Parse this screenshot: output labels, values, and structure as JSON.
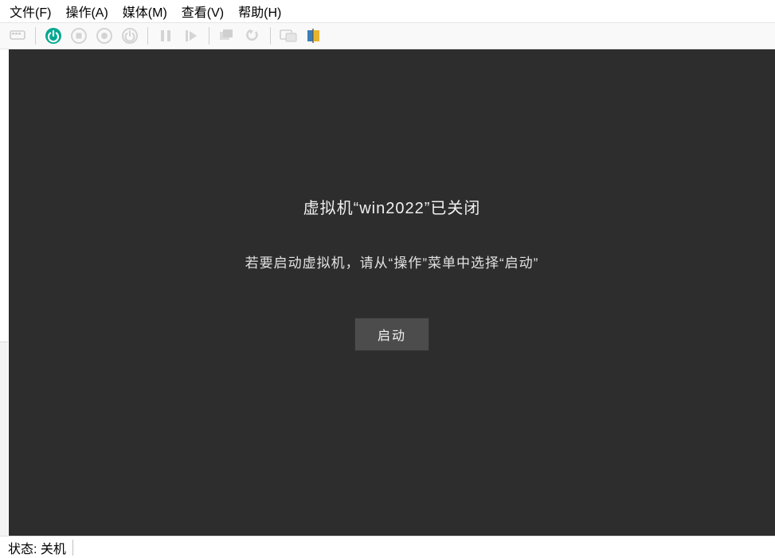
{
  "menu": {
    "file": "文件(F)",
    "action": "操作(A)",
    "media": "媒体(M)",
    "view": "查看(V)",
    "help": "帮助(H)"
  },
  "toolbar": {
    "ctrl_alt_del_icon": "ctrl-alt-del-icon",
    "start_icon": "power-on-icon",
    "turnoff_icon": "stop-icon",
    "shutdown_icon": "shutdown-icon",
    "save_icon": "save-state-icon",
    "pause_icon": "pause-icon",
    "reset_icon": "resume-icon",
    "checkpoint_icon": "checkpoint-icon",
    "revert_icon": "revert-icon",
    "enhanced_icon": "enhanced-session-icon",
    "share_icon": "share-icon"
  },
  "colors": {
    "power_green": "#00a890",
    "grey": "#b0b0b0",
    "dark_bg": "#2d2d2d"
  },
  "vm": {
    "title": "虚拟机“win2022”已关闭",
    "hint": "若要启动虚拟机，请从“操作”菜单中选择“启动”",
    "start_button": "启动"
  },
  "status": {
    "label": "状态: 关机"
  }
}
